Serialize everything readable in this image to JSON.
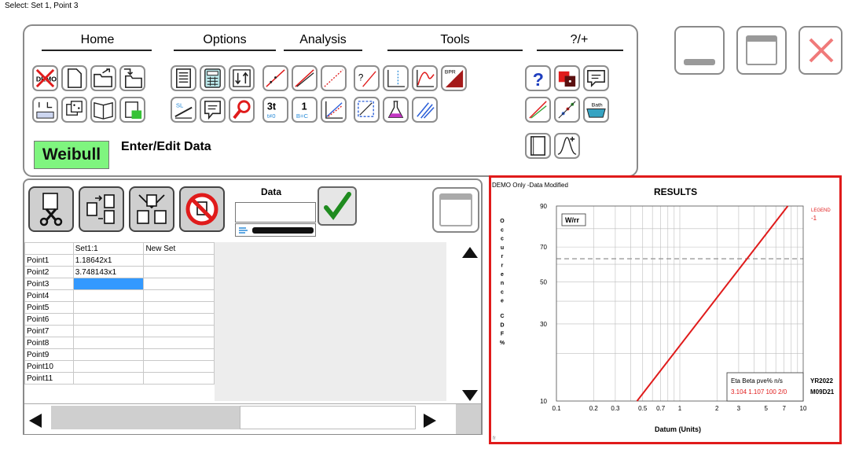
{
  "status_text": "Select: Set 1, Point 3",
  "menu": {
    "items": [
      "Home",
      "Options",
      "Analysis",
      "Tools",
      "?/+"
    ]
  },
  "ribbon": {
    "weibull_label": "Weibull",
    "enter_edit_label": "Enter/Edit Data"
  },
  "data_panel": {
    "data_title": "Data",
    "columns": [
      "",
      "Set1:1",
      "New Set"
    ],
    "rows": [
      {
        "label": "Point1",
        "set1": "1.18642x1",
        "newset": ""
      },
      {
        "label": "Point2",
        "set1": "3.748143x1",
        "newset": ""
      },
      {
        "label": "Point3",
        "set1": "",
        "newset": ""
      },
      {
        "label": "Point4",
        "set1": "",
        "newset": ""
      },
      {
        "label": "Point5",
        "set1": "",
        "newset": ""
      },
      {
        "label": "Point6",
        "set1": "",
        "newset": ""
      },
      {
        "label": "Point7",
        "set1": "",
        "newset": ""
      },
      {
        "label": "Point8",
        "set1": "",
        "newset": ""
      },
      {
        "label": "Point9",
        "set1": "",
        "newset": ""
      },
      {
        "label": "Point10",
        "set1": "",
        "newset": ""
      },
      {
        "label": "Point11",
        "set1": "",
        "newset": ""
      }
    ],
    "selected_row": 2
  },
  "results": {
    "demo_note": "DEMO Only -Data Modified",
    "title": "RESULTS",
    "legend_label": "LEGEND",
    "legend_value": "-1",
    "fit_tag": "W/rr",
    "ylabel": "Occurrence CDF %",
    "xlabel": "Datum (Units)",
    "stats_header": "Eta  Beta  pve% n/s",
    "stats_values": "3.104 1.107 100   2/0",
    "date_line1": "YR2022",
    "date_line2": "M09D21",
    "corner_mark": "fr",
    "colors": {
      "line": "#e01b1b",
      "grid": "#bdbdbd"
    }
  },
  "chart_data": {
    "type": "line",
    "title": "RESULTS",
    "xlabel": "Datum (Units)",
    "ylabel": "Occurrence CDF %",
    "x_scale": "log",
    "y_scale": "weibull",
    "xlim": [
      0.1,
      10
    ],
    "ylim": [
      10,
      90
    ],
    "x_ticks": [
      0.1,
      0.2,
      0.3,
      0.5,
      0.7,
      1,
      2,
      3,
      5,
      7,
      10
    ],
    "y_ticks": [
      10,
      30,
      50,
      70,
      90
    ],
    "grid": true,
    "reference_line_y": 63.2,
    "series": [
      {
        "name": "-1",
        "x": [
          0.45,
          7.5
        ],
        "y": [
          10,
          90
        ]
      }
    ],
    "fit": {
      "eta": 3.104,
      "beta": 1.107,
      "pve_percent": 100,
      "n_s": "2/0"
    }
  }
}
